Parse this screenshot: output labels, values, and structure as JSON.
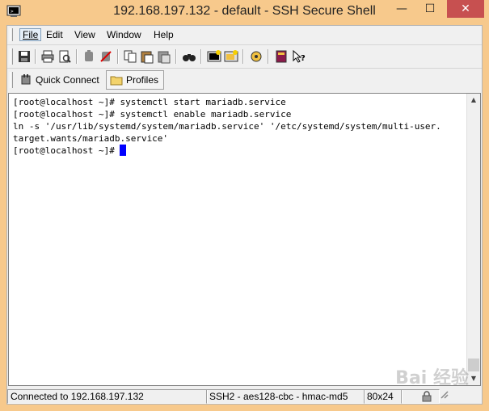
{
  "window": {
    "title": "192.168.197.132 - default - SSH Secure Shell",
    "minimize_glyph": "—",
    "maximize_glyph": "☐",
    "close_glyph": "✕"
  },
  "menu": {
    "items": [
      "File",
      "Edit",
      "View",
      "Window",
      "Help"
    ]
  },
  "toolbar": {
    "icons": [
      "save-icon",
      "print-icon",
      "print-preview-icon",
      "disconnect-icon",
      "reconnect-icon",
      "copy-icon",
      "paste-icon",
      "paste-selection-icon",
      "find-icon",
      "new-terminal-icon",
      "new-file-transfer-icon",
      "settings-icon",
      "help-book-icon",
      "context-help-icon"
    ]
  },
  "quickbar": {
    "quick_connect_label": "Quick Connect",
    "profiles_label": "Profiles"
  },
  "terminal": {
    "lines": [
      "[root@localhost ~]# systemctl start mariadb.service",
      "[root@localhost ~]# systemctl enable mariadb.service",
      "ln -s '/usr/lib/systemd/system/mariadb.service' '/etc/systemd/system/multi-user.",
      "target.wants/mariadb.service'",
      "[root@localhost ~]# "
    ],
    "cursor_color": "#0000ff"
  },
  "status": {
    "connection": "Connected to 192.168.197.132",
    "cipher": "SSH2 - aes128-cbc - hmac-md5",
    "size": "80x24"
  },
  "watermark": "Bai 经验",
  "colors": {
    "title_bg": "#f7c98c",
    "close_button": "#c75050"
  }
}
